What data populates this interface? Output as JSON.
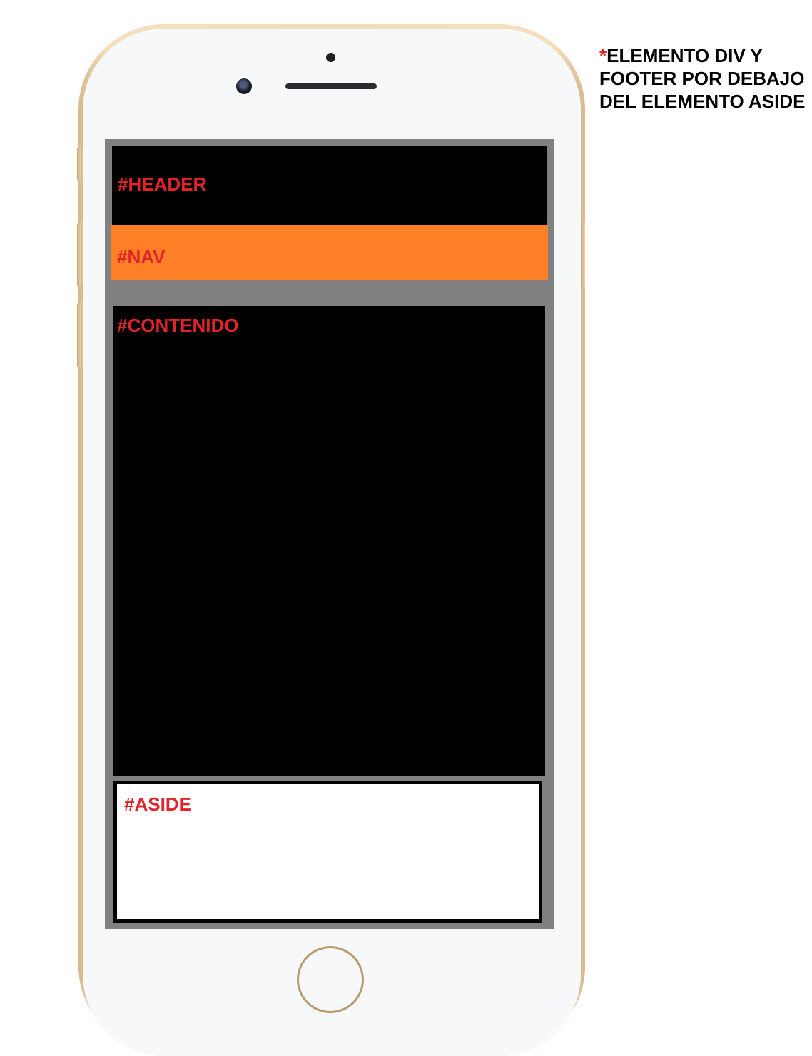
{
  "colors": {
    "label": "#e3232a",
    "nav": "#ff7f27",
    "screen_frame": "#808080",
    "dark_block": "#000000",
    "aside_fill": "#ffffff",
    "phone_gold": "#f1dcc0"
  },
  "icons": {
    "camera": "front-camera-icon",
    "speaker": "speaker-icon",
    "sensor": "proximity-sensor-icon",
    "home": "home-button-icon"
  },
  "layout_blocks": {
    "header": {
      "label": "#HEADER"
    },
    "nav": {
      "label": "#NAV"
    },
    "contenido": {
      "label": "#CONTENIDO"
    },
    "aside": {
      "label": "#ASIDE"
    }
  },
  "note": {
    "asterisk": "*",
    "text": "ELEMENTO DIV Y FOOTER POR DEBAJO DEL ELEMENTO ASIDE"
  }
}
